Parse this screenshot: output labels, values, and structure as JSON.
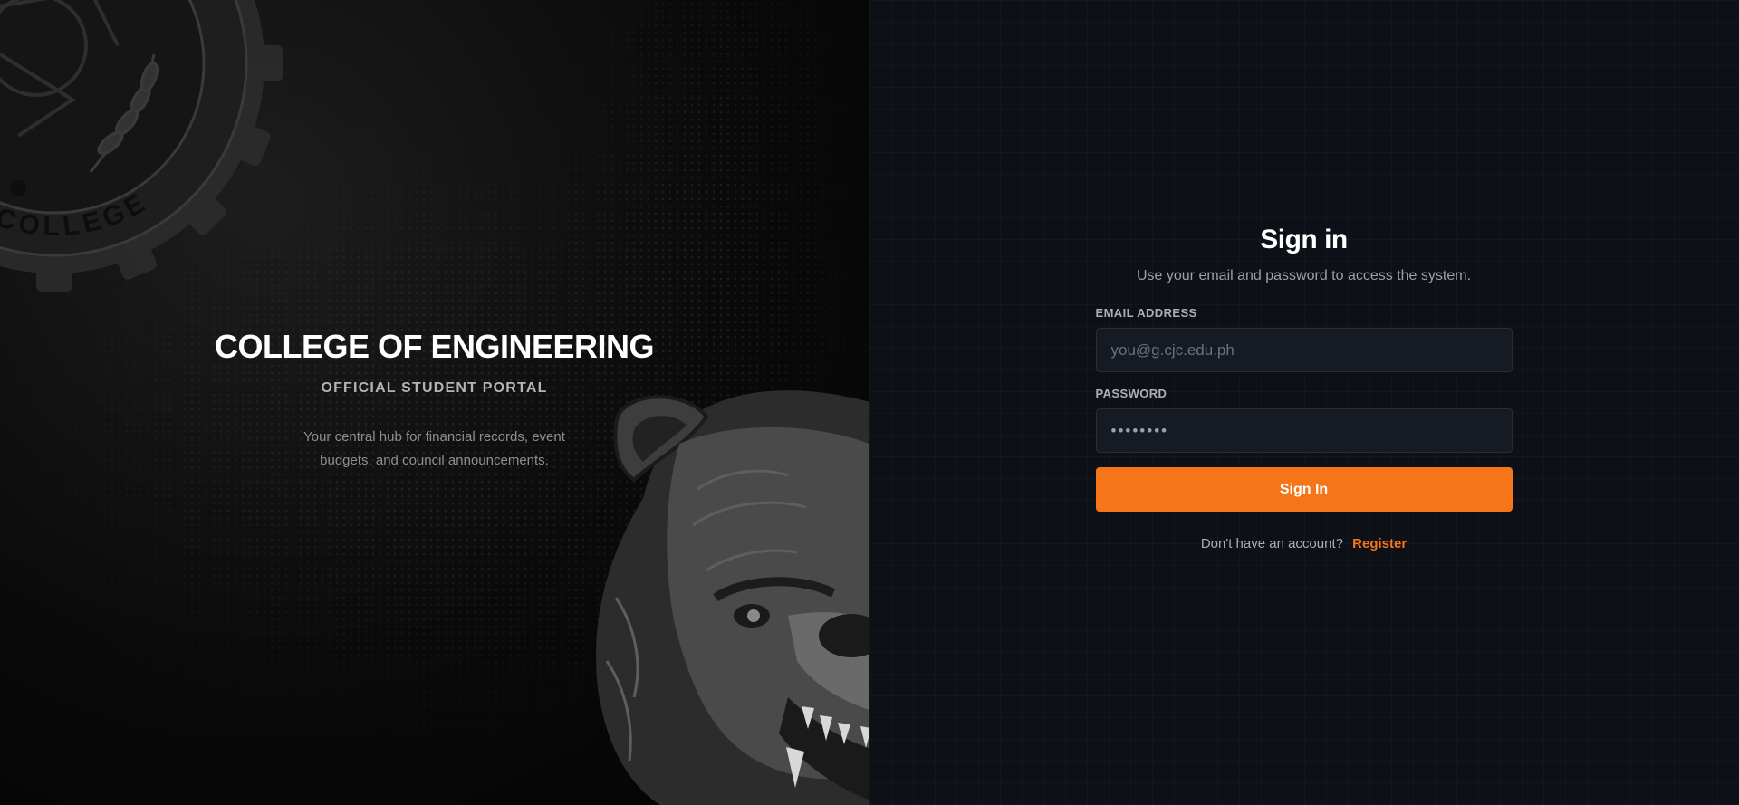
{
  "hero": {
    "title": "COLLEGE OF ENGINEERING",
    "subtitle": "OFFICIAL STUDENT PORTAL",
    "description": "Your central hub for financial records, event budgets, and council announcements.",
    "seal_text": "COR JESU COLLEGE",
    "seal_icon": "college-seal-logo",
    "mascot_icon": "bear-mascot"
  },
  "auth": {
    "title": "Sign in",
    "subtitle": "Use your email and password to access the system.",
    "email": {
      "label": "EMAIL ADDRESS",
      "placeholder": "you@g.cjc.edu.ph",
      "value": ""
    },
    "password": {
      "label": "PASSWORD",
      "placeholder": "••••••••",
      "value": ""
    },
    "submit_label": "Sign In",
    "register_prompt": "Don't have an account?",
    "register_link": "Register"
  },
  "colors": {
    "accent": "#f57518",
    "panel_background": "#0d1016",
    "input_background": "#161b23"
  }
}
